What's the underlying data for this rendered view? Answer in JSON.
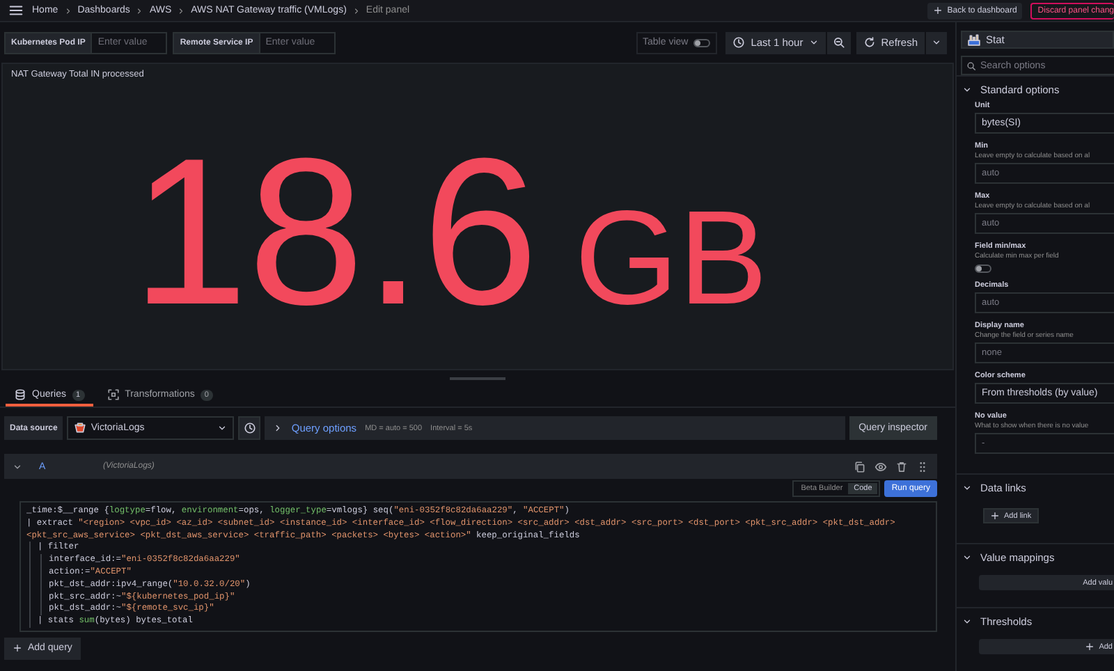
{
  "topbar": {
    "breadcrumbs": [
      {
        "label": "Home",
        "current": false
      },
      {
        "label": "Dashboards",
        "current": false
      },
      {
        "label": "AWS",
        "current": false
      },
      {
        "label": "AWS NAT Gateway traffic (VMLogs)",
        "current": false
      },
      {
        "label": "Edit panel",
        "current": true
      }
    ],
    "buttons": [
      {
        "label": "Back to dashboard",
        "kind": "back"
      },
      {
        "label": "Discard panel chang",
        "kind": "danger"
      }
    ]
  },
  "variables": [
    {
      "label": "Kubernetes Pod IP",
      "placeholder": "Enter value"
    },
    {
      "label": "Remote Service IP",
      "placeholder": "Enter value"
    }
  ],
  "toolbar": {
    "table_view": {
      "label": "Table view",
      "on": false
    },
    "time_range": "Last 1 hour",
    "refresh": "Refresh"
  },
  "panel": {
    "title": "NAT Gateway Total IN processed",
    "value": "18.6",
    "unit": "GB"
  },
  "query_tabs": [
    {
      "label": "Queries",
      "count": "1",
      "selected": true
    },
    {
      "label": "Transformations",
      "count": "0",
      "selected": false
    }
  ],
  "data_source": {
    "label": "Data source",
    "value": "VictoriaLogs",
    "query_options": "Query options",
    "md": "MD = auto = 500",
    "interval": "Interval = 5s",
    "inspector": "Query inspector"
  },
  "query": {
    "ref": "A",
    "source": "(VictoriaLogs)",
    "expanded": true,
    "modes": [
      {
        "label": "Beta Builder",
        "selected": false
      },
      {
        "label": "Code",
        "selected": true
      }
    ],
    "run": "Run query",
    "lines": [
      {
        "segments": [
          {
            "kind": "plain",
            "text": "_time:$__range {"
          },
          {
            "kind": "key",
            "text": "logtype"
          },
          {
            "kind": "plain",
            "text": "=flow, "
          },
          {
            "kind": "key",
            "text": "environment"
          },
          {
            "kind": "plain",
            "text": "=ops, "
          },
          {
            "kind": "key",
            "text": "logger_type"
          },
          {
            "kind": "plain",
            "text": "=vmlogs} seq("
          },
          {
            "kind": "string",
            "text": "\"eni-0352f8c82da6aa229\""
          },
          {
            "kind": "plain",
            "text": ", "
          },
          {
            "kind": "string",
            "text": "\"ACCEPT\""
          },
          {
            "kind": "plain",
            "text": ")"
          }
        ]
      },
      {
        "segments": [
          {
            "kind": "plain",
            "text": "| extract "
          },
          {
            "kind": "string",
            "text": "\"<region> <vpc_id> <az_id> <subnet_id> <instance_id> <interface_id> <flow_direction> <src_addr> <dst_addr> <src_port> <dst_port> <pkt_src_addr> <pkt_dst_addr> <pkt_src_aws_service> <pkt_dst_aws_service> <traffic_path> <packets> <bytes> <action>\""
          },
          {
            "kind": "plain",
            "text": " keep_original_fields"
          }
        ],
        "children": [
          {
            "segments": [
              {
                "kind": "plain",
                "text": "| filter"
              }
            ],
            "children": [
              {
                "segments": [
                  {
                    "kind": "plain",
                    "text": "interface_id:="
                  },
                  {
                    "kind": "string",
                    "text": "\"eni-0352f8c82da6aa229\""
                  }
                ]
              },
              {
                "segments": [
                  {
                    "kind": "plain",
                    "text": "action:="
                  },
                  {
                    "kind": "string",
                    "text": "\"ACCEPT\""
                  }
                ]
              },
              {
                "segments": [
                  {
                    "kind": "plain",
                    "text": "pkt_dst_addr:ipv4_range("
                  },
                  {
                    "kind": "string",
                    "text": "\"10.0.32.0/20\""
                  },
                  {
                    "kind": "plain",
                    "text": ")"
                  }
                ]
              },
              {
                "segments": [
                  {
                    "kind": "plain",
                    "text": "pkt_src_addr:~"
                  },
                  {
                    "kind": "string",
                    "text": "\"${kubernetes_pod_ip}\""
                  }
                ]
              },
              {
                "segments": [
                  {
                    "kind": "plain",
                    "text": "pkt_dst_addr:~"
                  },
                  {
                    "kind": "string",
                    "text": "\"${remote_svc_ip}\""
                  }
                ]
              }
            ]
          },
          {
            "segments": [
              {
                "kind": "plain",
                "text": "| stats "
              },
              {
                "kind": "func",
                "text": "sum"
              },
              {
                "kind": "plain",
                "text": "(bytes) bytes_total"
              }
            ]
          }
        ]
      }
    ]
  },
  "add_query": "Add query",
  "options": {
    "visualization": "Stat",
    "search_placeholder": "Search options",
    "sections": [
      {
        "title": "Standard options",
        "expanded": true,
        "fields": [
          {
            "kind": "select",
            "label": "Unit",
            "value": "bytes(SI)"
          },
          {
            "kind": "input",
            "label": "Min",
            "hint": "Leave empty to calculate based on al",
            "placeholder": "auto"
          },
          {
            "kind": "input",
            "label": "Max",
            "hint": "Leave empty to calculate based on al",
            "placeholder": "auto"
          },
          {
            "kind": "toggle",
            "label": "Field min/max",
            "hint": "Calculate min max per field",
            "on": false
          },
          {
            "kind": "input",
            "label": "Decimals",
            "placeholder": "auto"
          },
          {
            "kind": "input",
            "label": "Display name",
            "hint": "Change the field or series name",
            "placeholder": "none"
          },
          {
            "kind": "select",
            "label": "Color scheme",
            "value": "From thresholds (by value)"
          },
          {
            "kind": "input",
            "label": "No value",
            "hint": "What to show when there is no value",
            "placeholder": "-"
          }
        ]
      },
      {
        "title": "Data links",
        "expanded": true,
        "button": {
          "label": "Add link",
          "kind": "small",
          "plus": true
        }
      },
      {
        "title": "Value mappings",
        "expanded": true,
        "button": {
          "label": "Add valu",
          "kind": "wide",
          "plus": false
        }
      },
      {
        "title": "Thresholds",
        "expanded": true,
        "button": {
          "label": "Add",
          "kind": "wide",
          "plus": true
        }
      }
    ]
  }
}
